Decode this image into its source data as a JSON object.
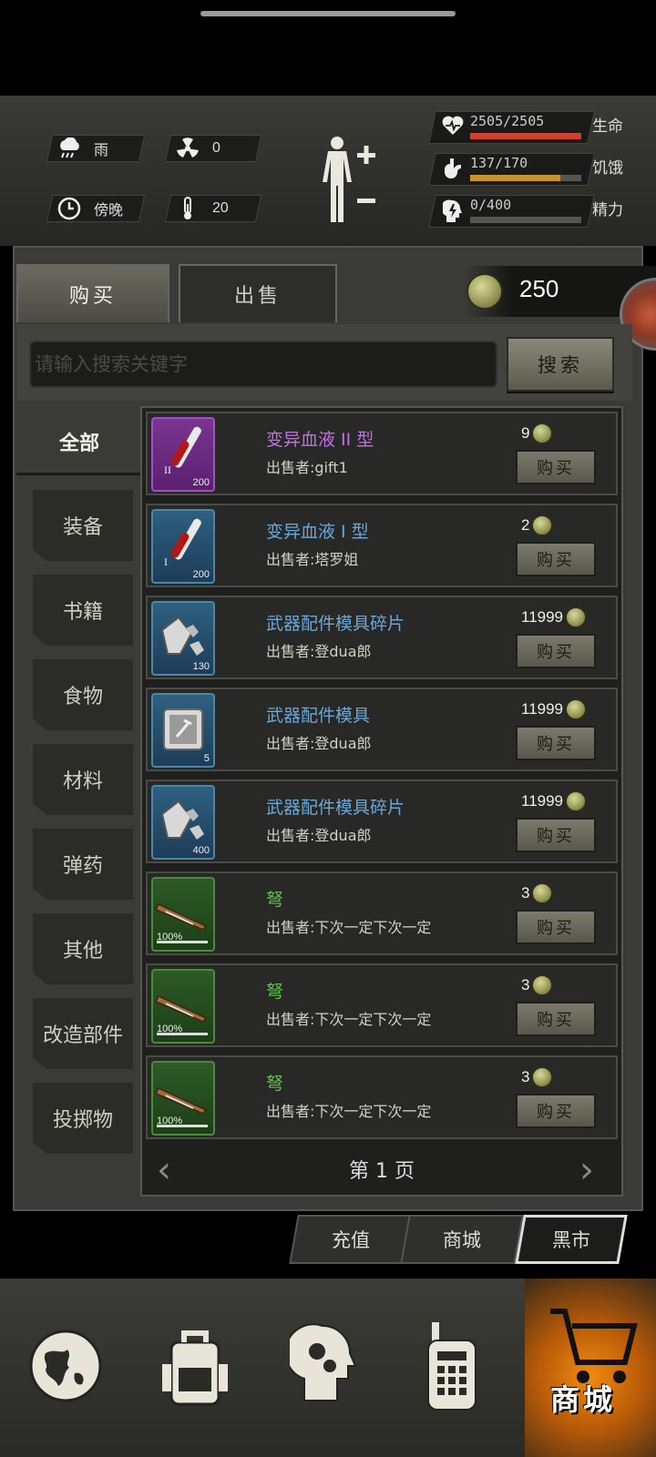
{
  "status": {
    "weather": "雨",
    "radiation": "0",
    "time_of_day": "傍晚",
    "temperature": "20"
  },
  "vitals": [
    {
      "value": "2505/2505",
      "label": "生命",
      "fill": 1.0,
      "color": "#d0402e",
      "icon": "heart-pulse-icon"
    },
    {
      "value": "137/170",
      "label": "饥饿",
      "fill": 0.81,
      "color": "#c8932e",
      "icon": "stomach-icon"
    },
    {
      "value": "0/400",
      "label": "精力",
      "fill": 0.0,
      "color": "#2e7fc8",
      "icon": "head-bolt-icon"
    }
  ],
  "tabs": {
    "buy": "购买",
    "sell": "出售"
  },
  "currency": {
    "amount": "250"
  },
  "search": {
    "placeholder": "请输入搜索关键字",
    "button": "搜索"
  },
  "categories": [
    "全部",
    "装备",
    "书籍",
    "食物",
    "材料",
    "弹药",
    "其他",
    "改造部件",
    "投掷物"
  ],
  "items": [
    {
      "name": "变异血液 II 型",
      "seller": "出售者:gift1",
      "price": "9",
      "qty": "200",
      "tier": "II",
      "rarity": "purple",
      "name_color": "#c070e8",
      "icon": "blood-vial-icon"
    },
    {
      "name": "变异血液 I 型",
      "seller": "出售者:塔罗姐",
      "price": "2",
      "qty": "200",
      "tier": "I",
      "rarity": "blue",
      "name_color": "#6aa6d8",
      "icon": "blood-vial-icon"
    },
    {
      "name": "武器配件模具碎片",
      "seller": "出售者:登dua郎",
      "price": "11999",
      "qty": "130",
      "tier": "",
      "rarity": "blue",
      "name_color": "#6aa6d8",
      "icon": "mold-fragment-icon"
    },
    {
      "name": "武器配件模具",
      "seller": "出售者:登dua郎",
      "price": "11999",
      "qty": "5",
      "tier": "",
      "rarity": "blue",
      "name_color": "#6aa6d8",
      "icon": "mold-icon"
    },
    {
      "name": "武器配件模具碎片",
      "seller": "出售者:登dua郎",
      "price": "11999",
      "qty": "400",
      "tier": "",
      "rarity": "blue",
      "name_color": "#6aa6d8",
      "icon": "mold-fragment-icon"
    },
    {
      "name": "弩",
      "seller": "出售者:下次一定下次一定",
      "price": "3",
      "qty": "100%",
      "tier": "",
      "rarity": "green",
      "name_color": "#5cc24a",
      "icon": "crossbow-icon"
    },
    {
      "name": "弩",
      "seller": "出售者:下次一定下次一定",
      "price": "3",
      "qty": "100%",
      "tier": "",
      "rarity": "green",
      "name_color": "#5cc24a",
      "icon": "crossbow-icon"
    },
    {
      "name": "弩",
      "seller": "出售者:下次一定下次一定",
      "price": "3",
      "qty": "100%",
      "tier": "",
      "rarity": "green",
      "name_color": "#5cc24a",
      "icon": "crossbow-icon"
    }
  ],
  "buy_label": "购买",
  "pager": {
    "label": "第 1 页"
  },
  "lower_tabs": [
    "充值",
    "商城",
    "黑市"
  ],
  "bottom_nav": {
    "shop_label": "商城"
  }
}
